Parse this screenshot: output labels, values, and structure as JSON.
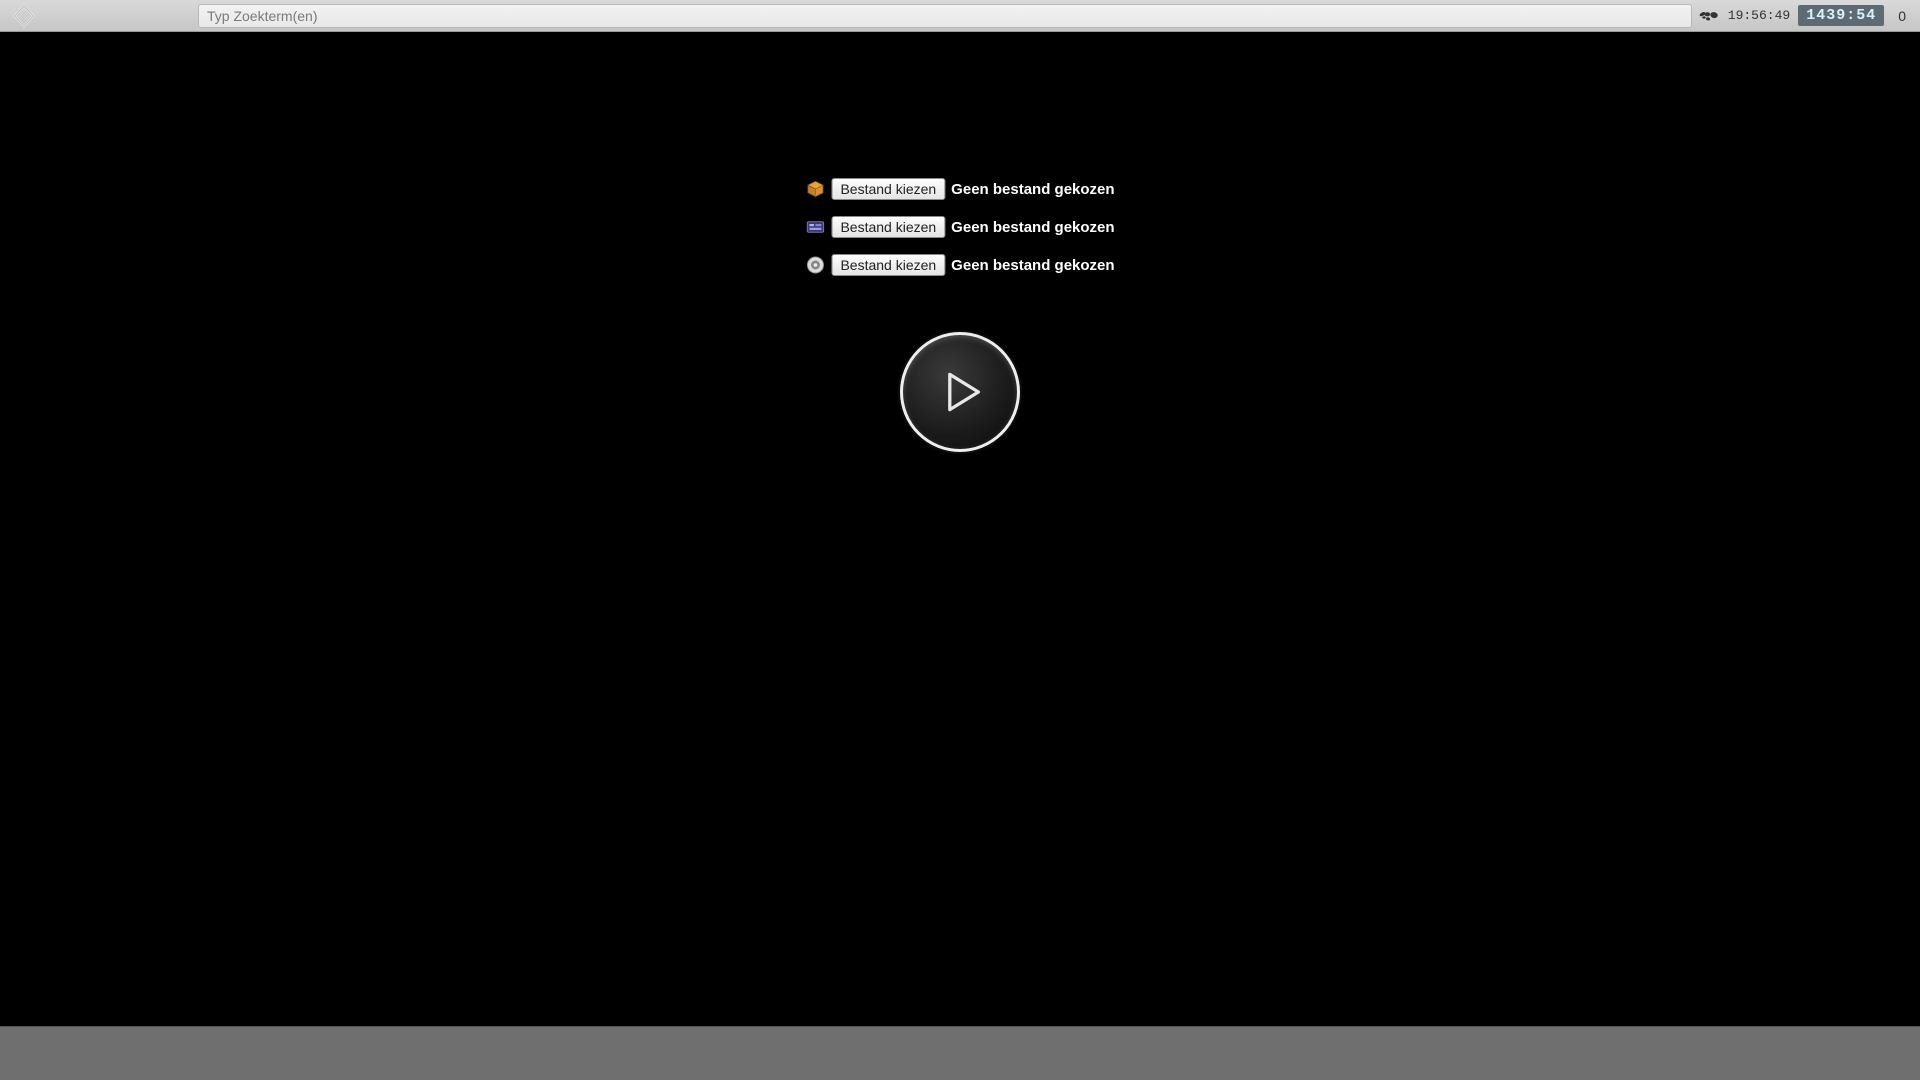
{
  "topbar": {
    "search_placeholder": "Typ Zoekterm(en)",
    "clock": "19:56:49",
    "timer": "1439:54",
    "count": "0"
  },
  "files": {
    "choose_label": "Bestand kiezen",
    "none_label": "Geen bestand gekozen",
    "rows": [
      {
        "icon": "cube-icon"
      },
      {
        "icon": "texture-icon"
      },
      {
        "icon": "disc-icon"
      }
    ]
  }
}
